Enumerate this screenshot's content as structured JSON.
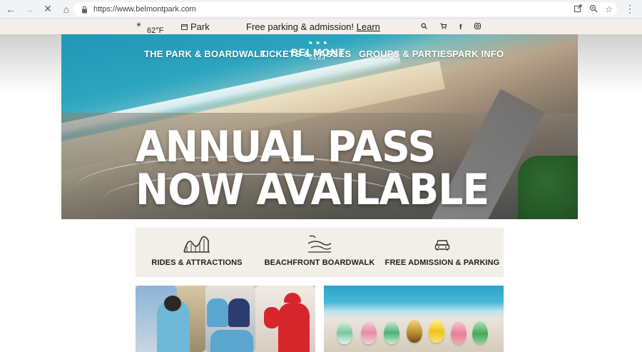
{
  "browser": {
    "url": "https://www.belmontpark.com",
    "nav_icons": [
      "back-arrow-icon",
      "forward-arrow-icon",
      "stop-loading-icon",
      "home-icon"
    ],
    "omnibox_icons": [
      "share-icon",
      "zoom-icon",
      "bookmark-star-icon"
    ]
  },
  "utility_bar": {
    "temperature": "62°F",
    "park_label": "Park",
    "promo_text": "Free parking & admission!",
    "promo_link": "Learn",
    "icons": [
      "search-icon",
      "cart-icon",
      "facebook-icon",
      "instagram-icon"
    ]
  },
  "hero": {
    "nav": [
      {
        "label": "THE PARK & BOARDWALK"
      },
      {
        "label": "TICKETS & PASSES"
      },
      {
        "label": "GROUPS & PARTIES"
      },
      {
        "label": "PARK INFO"
      }
    ],
    "logo": {
      "name": "BELMONT",
      "sub": "PARK"
    },
    "headline_line1": "ANNUAL PASS",
    "headline_line2": "NOW AVAILABLE"
  },
  "features": [
    {
      "label": "RIDES & ATTRACTIONS",
      "icon": "roller-coaster-icon"
    },
    {
      "label": "BEACHFRONT BOARDWALK",
      "icon": "beach-wave-icon"
    },
    {
      "label": "FREE ADMISSION & PARKING",
      "icon": "car-icon"
    }
  ],
  "colors": {
    "utility_bg": "#f3efe8",
    "feature_bg": "#f2efe9",
    "hero_ocean": "#2ba4bf"
  }
}
